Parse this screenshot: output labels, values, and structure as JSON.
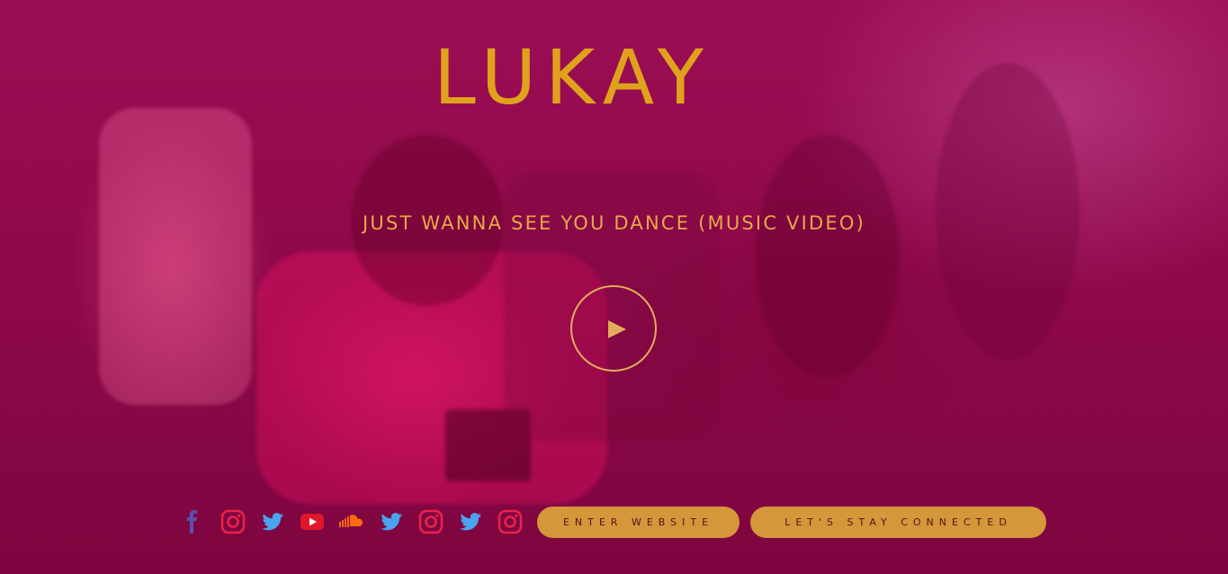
{
  "header": {
    "logo_text": "LUKAY"
  },
  "hero": {
    "video_title": "Just Wanna See You Dance (Music Video)",
    "play_icon": "play-icon"
  },
  "social_icons": [
    "facebook-icon",
    "instagram-icon",
    "twitter-icon",
    "youtube-icon",
    "soundcloud-icon",
    "twitter-icon",
    "instagram-icon",
    "twitter-icon",
    "instagram-icon"
  ],
  "buttons": {
    "enter_label": "Enter Website",
    "connect_label": "Let's Stay Connected"
  },
  "colors": {
    "accent_gold": "#e0a21c",
    "button_bg": "#d6963a",
    "background": "#8a0a45",
    "facebook": "#5b4fb3",
    "instagram": "#e8244a",
    "twitter": "#4aa3ef",
    "youtube": "#e0162b",
    "soundcloud": "#ff6a10"
  }
}
